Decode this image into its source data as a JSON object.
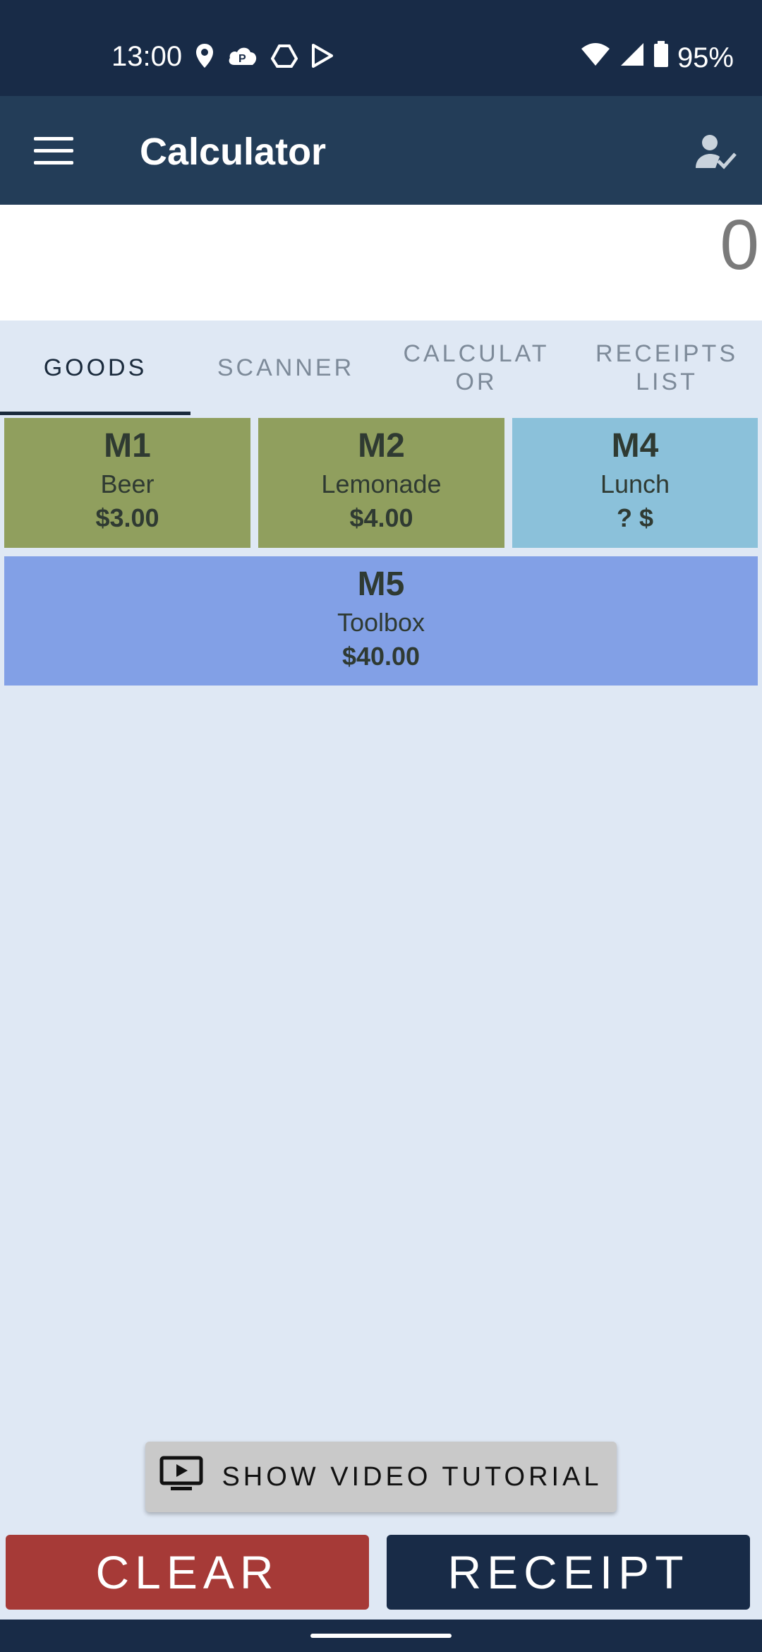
{
  "status_bar": {
    "time": "13:00",
    "left_icons": [
      "location-icon",
      "parking-cloud-icon",
      "drive-icon",
      "play-store-icon"
    ],
    "right_icons": [
      "wifi-icon",
      "signal-icon",
      "battery-icon"
    ],
    "battery": "95%"
  },
  "app_bar": {
    "title": "Calculator",
    "menu_icon": "hamburger-menu-icon",
    "user_icon": "user-check-icon"
  },
  "display": {
    "value": "0"
  },
  "tabs": [
    {
      "label": "GOODS",
      "active": true
    },
    {
      "label": "SCANNER",
      "active": false
    },
    {
      "label": "CALCULAT",
      "label2": "OR",
      "active": false
    },
    {
      "label": "RECEIPTS",
      "label2": "LIST",
      "active": false
    }
  ],
  "goods": [
    {
      "code": "M1",
      "name": "Beer",
      "price": "$3.00",
      "color": "#909f5e"
    },
    {
      "code": "M2",
      "name": "Lemonade",
      "price": "$4.00",
      "color": "#909f5e"
    },
    {
      "code": "M4",
      "name": "Lunch",
      "price": "? $",
      "color": "#8bc1da"
    },
    {
      "code": "M5",
      "name": "Toolbox",
      "price": "$40.00",
      "color": "#82a0e6"
    }
  ],
  "tutorial_button": {
    "label": "SHOW VIDEO TUTORIAL",
    "icon": "video-tutorial-icon"
  },
  "actions": {
    "clear": "CLEAR",
    "receipt": "RECEIPT"
  },
  "colors": {
    "status_bar": "#182b47",
    "app_bar": "#233d58",
    "background": "#dfe8f4",
    "clear_button": "#a63a37",
    "receipt_button": "#182b47"
  }
}
